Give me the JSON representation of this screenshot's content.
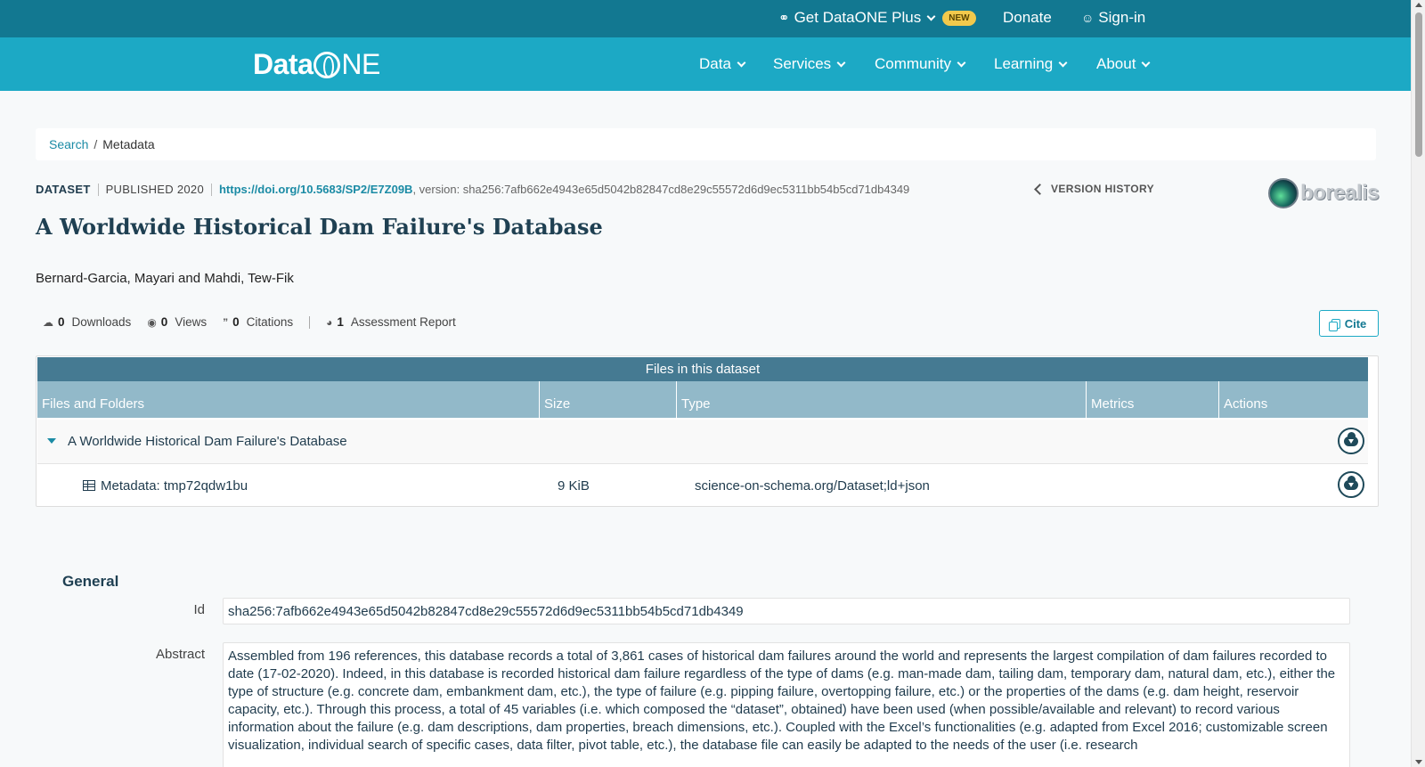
{
  "topbar": {
    "plus_label": "Get DataONE Plus",
    "new_badge": "NEW",
    "donate_label": "Donate",
    "signin_label": "Sign-in"
  },
  "logo": {
    "text_data": "Data",
    "text_ne": "NE"
  },
  "nav": [
    {
      "label": "Data"
    },
    {
      "label": "Services"
    },
    {
      "label": "Community"
    },
    {
      "label": "Learning"
    },
    {
      "label": "About"
    }
  ],
  "breadcrumb": {
    "link": "Search",
    "separator": "/",
    "current": "Metadata"
  },
  "meta": {
    "type": "DATASET",
    "published": "PUBLISHED 2020",
    "doi": "https://doi.org/10.5683/SP2/E7Z09B",
    "version": ", version: sha256:7afb662e4943e65d5042b82847cd8e29c55572d6d9ec5311bb54b5cd71db4349",
    "version_history": "VERSION HISTORY",
    "repository_logo": "borealis"
  },
  "title": "A Worldwide Historical Dam Failure's Database",
  "authors": "Bernard-Garcia, Mayari and Mahdi, Tew-Fik",
  "stats": {
    "downloads_count": "0",
    "downloads_label": "Downloads",
    "views_count": "0",
    "views_label": "Views",
    "citations_count": "0",
    "citations_label": "Citations",
    "assessment_count": "1",
    "assessment_label": "Assessment Report"
  },
  "cite_label": "Cite",
  "files": {
    "heading": "Files in this dataset",
    "columns": [
      "Files and Folders",
      "Size",
      "Type",
      "Metrics",
      "Actions"
    ],
    "rows": [
      {
        "name": "A Worldwide Historical Dam Failure's Database",
        "size": "",
        "type": ""
      },
      {
        "name": "Metadata: tmp72qdw1bu",
        "size": "9 KiB",
        "type": "science-on-schema.org/Dataset;ld+json"
      }
    ]
  },
  "general": {
    "heading": "General",
    "id_label": "Id",
    "id_value": "sha256:7afb662e4943e65d5042b82847cd8e29c55572d6d9ec5311bb54b5cd71db4349",
    "abstract_label": "Abstract",
    "abstract_value": "Assembled from 196 references, this database records a total of 3,861 cases of historical dam failures around the world and represents the largest compilation of dam failures recorded to date (17-02-2020). Indeed, in this database is recorded historical dam failure regardless of the type of dams (e.g. man-made dam, tailing dam, temporary dam, natural dam, etc.), either the type of structure (e.g. concrete dam, embankment dam, etc.), the type of failure (e.g. pipping failure, overtopping failure, etc.) or the properties of the dams (e.g. dam height, reservoir capacity, etc.). Through this process, a total of 45 variables (i.e. which composed the “dataset”, obtained) have been used (when possible/available and relevant) to record various information about the failure (e.g. dam descriptions, dam properties, breach dimensions, etc.). Coupled with the Excel’s functionalities (e.g. adapted from Excel 2016; customizable screen visualization, individual search of specific cases, data filter, pivot table, etc.), the database file can easily be adapted to the needs of the user (i.e. research"
  }
}
